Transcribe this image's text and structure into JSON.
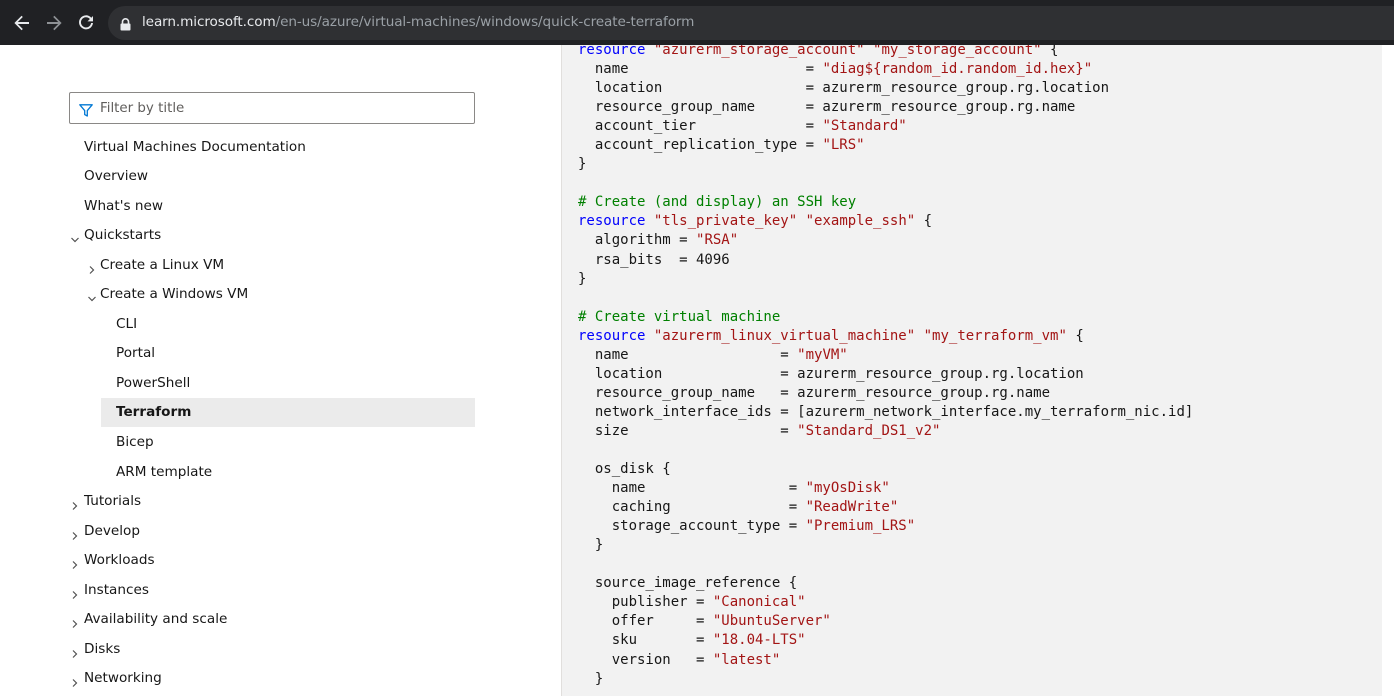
{
  "browser": {
    "url_host": "learn.microsoft.com",
    "url_path": "/en-us/azure/virtual-machines/windows/quick-create-terraform"
  },
  "sidebar": {
    "filter_placeholder": "Filter by title",
    "items": [
      {
        "label": "Virtual Machines Documentation",
        "level": 0,
        "chevron": "none"
      },
      {
        "label": "Overview",
        "level": 0,
        "chevron": "none"
      },
      {
        "label": "What's new",
        "level": 0,
        "chevron": "none"
      },
      {
        "label": "Quickstarts",
        "level": 0,
        "chevron": "down"
      },
      {
        "label": "Create a Linux VM",
        "level": 1,
        "chevron": "right"
      },
      {
        "label": "Create a Windows VM",
        "level": 1,
        "chevron": "down"
      },
      {
        "label": "CLI",
        "level": 2,
        "chevron": "none"
      },
      {
        "label": "Portal",
        "level": 2,
        "chevron": "none"
      },
      {
        "label": "PowerShell",
        "level": 2,
        "chevron": "none"
      },
      {
        "label": "Terraform",
        "level": 2,
        "chevron": "none",
        "active": true
      },
      {
        "label": "Bicep",
        "level": 2,
        "chevron": "none"
      },
      {
        "label": "ARM template",
        "level": 2,
        "chevron": "none"
      },
      {
        "label": "Tutorials",
        "level": 0,
        "chevron": "right"
      },
      {
        "label": "Develop",
        "level": 0,
        "chevron": "right"
      },
      {
        "label": "Workloads",
        "level": 0,
        "chevron": "right"
      },
      {
        "label": "Instances",
        "level": 0,
        "chevron": "right"
      },
      {
        "label": "Availability and scale",
        "level": 0,
        "chevron": "right"
      },
      {
        "label": "Disks",
        "level": 0,
        "chevron": "right"
      },
      {
        "label": "Networking",
        "level": 0,
        "chevron": "right"
      }
    ]
  },
  "code": {
    "lines": [
      [
        [
          "kw",
          "resource"
        ],
        [
          "p",
          " "
        ],
        [
          "str",
          "\"azurerm_storage_account\""
        ],
        [
          "p",
          " "
        ],
        [
          "str",
          "\"my_storage_account\""
        ],
        [
          "p",
          " {"
        ]
      ],
      [
        [
          "p",
          "  name                     = "
        ],
        [
          "str",
          "\"diag${random_id.random_id.hex}\""
        ]
      ],
      [
        [
          "p",
          "  location                 = azurerm_resource_group.rg.location"
        ]
      ],
      [
        [
          "p",
          "  resource_group_name      = azurerm_resource_group.rg.name"
        ]
      ],
      [
        [
          "p",
          "  account_tier             = "
        ],
        [
          "str",
          "\"Standard\""
        ]
      ],
      [
        [
          "p",
          "  account_replication_type = "
        ],
        [
          "str",
          "\"LRS\""
        ]
      ],
      [
        [
          "p",
          "}"
        ]
      ],
      [
        [
          "p",
          ""
        ]
      ],
      [
        [
          "cm",
          "# Create (and display) an SSH key"
        ]
      ],
      [
        [
          "kw",
          "resource"
        ],
        [
          "p",
          " "
        ],
        [
          "str",
          "\"tls_private_key\""
        ],
        [
          "p",
          " "
        ],
        [
          "str",
          "\"example_ssh\""
        ],
        [
          "p",
          " {"
        ]
      ],
      [
        [
          "p",
          "  algorithm = "
        ],
        [
          "str",
          "\"RSA\""
        ]
      ],
      [
        [
          "p",
          "  rsa_bits  = 4096"
        ]
      ],
      [
        [
          "p",
          "}"
        ]
      ],
      [
        [
          "p",
          ""
        ]
      ],
      [
        [
          "cm",
          "# Create virtual machine"
        ]
      ],
      [
        [
          "kw",
          "resource"
        ],
        [
          "p",
          " "
        ],
        [
          "str",
          "\"azurerm_linux_virtual_machine\""
        ],
        [
          "p",
          " "
        ],
        [
          "str",
          "\"my_terraform_vm\""
        ],
        [
          "p",
          " {"
        ]
      ],
      [
        [
          "p",
          "  name                  = "
        ],
        [
          "str",
          "\"myVM\""
        ]
      ],
      [
        [
          "p",
          "  location              = azurerm_resource_group.rg.location"
        ]
      ],
      [
        [
          "p",
          "  resource_group_name   = azurerm_resource_group.rg.name"
        ]
      ],
      [
        [
          "p",
          "  network_interface_ids = [azurerm_network_interface.my_terraform_nic.id]"
        ]
      ],
      [
        [
          "p",
          "  size                  = "
        ],
        [
          "str",
          "\"Standard_DS1_v2\""
        ]
      ],
      [
        [
          "p",
          ""
        ]
      ],
      [
        [
          "p",
          "  os_disk {"
        ]
      ],
      [
        [
          "p",
          "    name                 = "
        ],
        [
          "str",
          "\"myOsDisk\""
        ]
      ],
      [
        [
          "p",
          "    caching              = "
        ],
        [
          "str",
          "\"ReadWrite\""
        ]
      ],
      [
        [
          "p",
          "    storage_account_type = "
        ],
        [
          "str",
          "\"Premium_LRS\""
        ]
      ],
      [
        [
          "p",
          "  }"
        ]
      ],
      [
        [
          "p",
          ""
        ]
      ],
      [
        [
          "p",
          "  source_image_reference {"
        ]
      ],
      [
        [
          "p",
          "    publisher = "
        ],
        [
          "str",
          "\"Canonical\""
        ]
      ],
      [
        [
          "p",
          "    offer     = "
        ],
        [
          "str",
          "\"UbuntuServer\""
        ]
      ],
      [
        [
          "p",
          "    sku       = "
        ],
        [
          "str",
          "\"18.04-LTS\""
        ]
      ],
      [
        [
          "p",
          "    version   = "
        ],
        [
          "str",
          "\"latest\""
        ]
      ],
      [
        [
          "p",
          "  }"
        ]
      ]
    ]
  }
}
